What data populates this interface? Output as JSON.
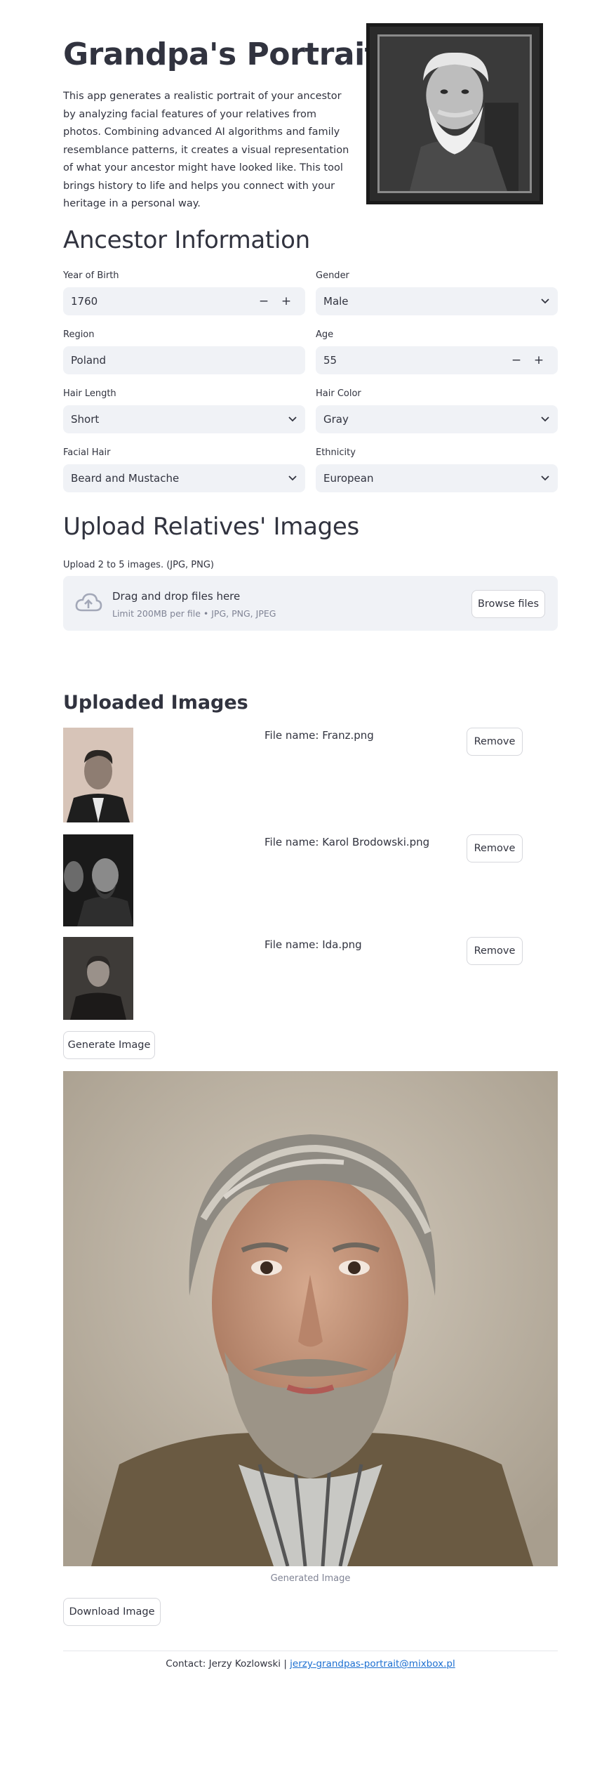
{
  "header": {
    "title": "Grandpa's Portrait",
    "description": "This app generates a realistic portrait of your ancestor by analyzing facial features of your relatives from photos. Combining advanced AI algorithms and family resemblance patterns, it creates a visual representation of what your ancestor might have looked like. This tool brings history to life and helps you connect with your heritage in a personal way."
  },
  "ancestor": {
    "title": "Ancestor Information",
    "fields": {
      "year_of_birth": {
        "label": "Year of Birth",
        "value": "1760"
      },
      "gender": {
        "label": "Gender",
        "value": "Male"
      },
      "region": {
        "label": "Region",
        "value": "Poland"
      },
      "age": {
        "label": "Age",
        "value": "55"
      },
      "hair_length": {
        "label": "Hair Length",
        "value": "Short"
      },
      "hair_color": {
        "label": "Hair Color",
        "value": "Gray"
      },
      "facial_hair": {
        "label": "Facial Hair",
        "value": "Beard and Mustache"
      },
      "ethnicity": {
        "label": "Ethnicity",
        "value": "European"
      }
    },
    "stepper_minus": "−",
    "stepper_plus": "+"
  },
  "upload": {
    "title": "Upload Relatives' Images",
    "note": "Upload 2 to 5 images. (JPG, PNG)",
    "drop_text": "Drag and drop files here",
    "limit_text": "Limit 200MB per file • JPG, PNG, JPEG",
    "browse_label": "Browse files"
  },
  "uploaded": {
    "title": "Uploaded Images",
    "remove_label": "Remove",
    "files": [
      {
        "label": "File name: Franz.png"
      },
      {
        "label": "File name: Karol Brodowski.png"
      },
      {
        "label": "File name: Ida.png"
      }
    ]
  },
  "generate_label": "Generate Image",
  "generated_caption": "Generated Image",
  "download_label": "Download Image",
  "footer": {
    "contact": "Contact: Jerzy Kozlowski | ",
    "email": "jerzy-grandpas-portrait@mixbox.pl"
  },
  "colors": {
    "input_bg": "#f0f2f6",
    "text": "#31333f",
    "muted": "#808495",
    "link": "#1c6fd1"
  }
}
